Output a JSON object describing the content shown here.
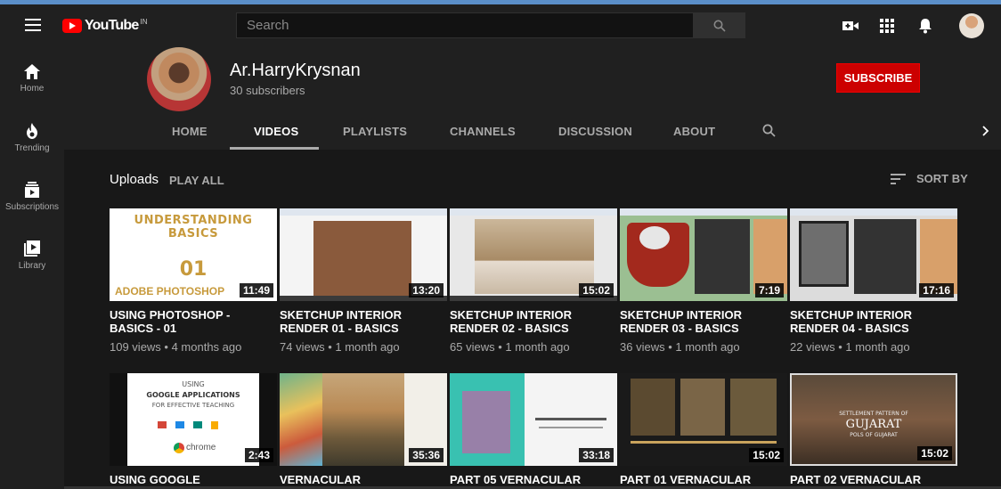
{
  "masthead": {
    "logo_text": "YouTube",
    "logo_region": "IN",
    "search_placeholder": "Search"
  },
  "guide": [
    {
      "label": "Home",
      "icon": "home-icon"
    },
    {
      "label": "Trending",
      "icon": "trending-icon"
    },
    {
      "label": "Subscriptions",
      "icon": "subscriptions-icon"
    },
    {
      "label": "Library",
      "icon": "library-icon"
    }
  ],
  "channel": {
    "name": "Ar.HarryKrysnan",
    "subscribers": "30 subscribers",
    "subscribe_label": "SUBSCRIBE"
  },
  "tabs": [
    {
      "label": "HOME"
    },
    {
      "label": "VIDEOS"
    },
    {
      "label": "PLAYLISTS"
    },
    {
      "label": "CHANNELS"
    },
    {
      "label": "DISCUSSION"
    },
    {
      "label": "ABOUT"
    }
  ],
  "uploads": {
    "title": "Uploads",
    "play_all": "PLAY ALL",
    "sort_by": "SORT BY"
  },
  "thumb_text": {
    "v1_line1": "UNDERSTANDING BASICS",
    "v1_line2": "01",
    "v1_line3": "ADOBE PHOTOSHOP",
    "v6_line1": "USING",
    "v6_line2": "GOOGLE APPLICATIONS",
    "v6_line3": "FOR EFFECTIVE TEACHING",
    "v6_line4": "chrome",
    "v10_line1": "SETTLEMENT PATTERN OF",
    "v10_line2": "GUJARAT",
    "v10_line3": "POLS OF GUJARAT"
  },
  "videos": [
    {
      "duration": "11:49",
      "title_line1": "USING PHOTOSHOP -",
      "title_line2": "BASICS - 01",
      "meta": "109 views • 4 months ago"
    },
    {
      "duration": "13:20",
      "title_line1": "SKETCHUP INTERIOR",
      "title_line2": "RENDER 01 - BASICS",
      "meta": "74 views • 1 month ago"
    },
    {
      "duration": "15:02",
      "title_line1": "SKETCHUP INTERIOR",
      "title_line2": "RENDER 02 - BASICS",
      "meta": "65 views • 1 month ago"
    },
    {
      "duration": "7:19",
      "title_line1": "SKETCHUP INTERIOR",
      "title_line2": "RENDER 03 - BASICS",
      "meta": "36 views • 1 month ago"
    },
    {
      "duration": "17:16",
      "title_line1": "SKETCHUP INTERIOR",
      "title_line2": "RENDER 04 - BASICS",
      "meta": "22 views • 1 month ago"
    },
    {
      "duration": "2:43",
      "title_line1": "USING GOOGLE",
      "title_line2": "",
      "meta": ""
    },
    {
      "duration": "35:36",
      "title_line1": "VERNACULAR",
      "title_line2": "",
      "meta": ""
    },
    {
      "duration": "33:18",
      "title_line1": "PART 05 VERNACULAR",
      "title_line2": "",
      "meta": ""
    },
    {
      "duration": "15:02",
      "title_line1": "PART 01 VERNACULAR",
      "title_line2": "",
      "meta": ""
    },
    {
      "duration": "15:02",
      "title_line1": "PART 02 VERNACULAR",
      "title_line2": "",
      "meta": ""
    }
  ],
  "colors": {
    "brand_red": "#ff0000",
    "subscribe_red": "#cc0000",
    "background": "#181818",
    "masthead": "#202020"
  }
}
